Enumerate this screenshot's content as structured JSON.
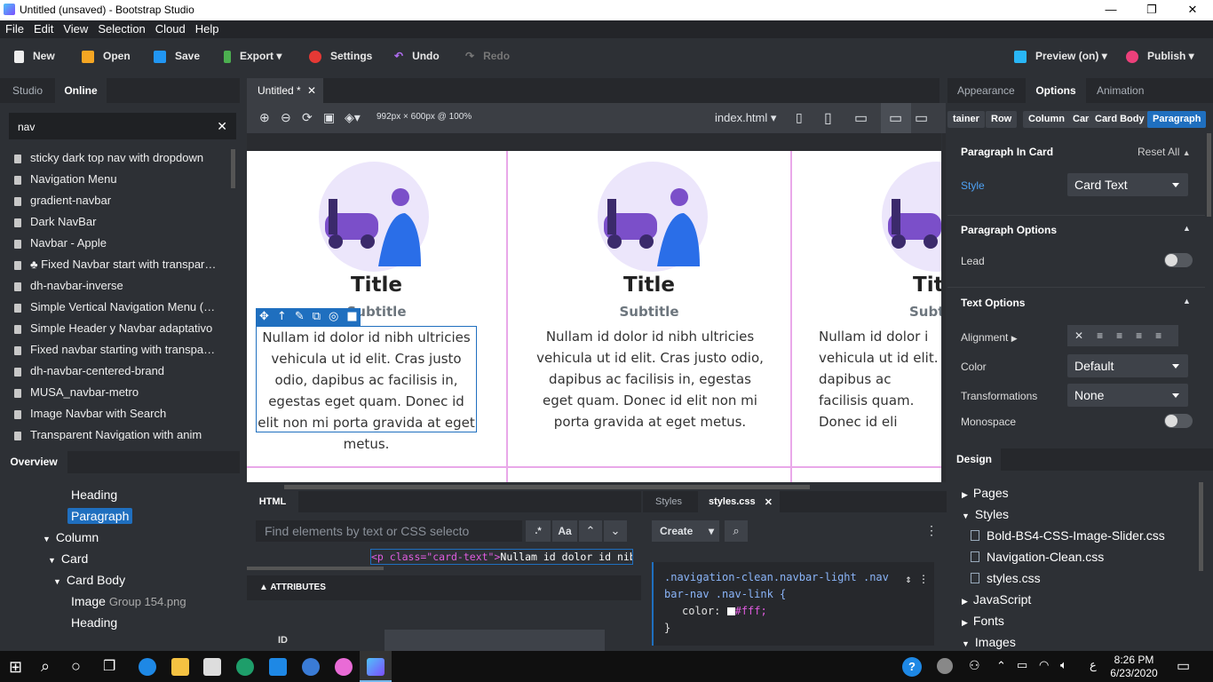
{
  "window": {
    "title": "Untitled (unsaved) - Bootstrap Studio"
  },
  "menu": [
    "File",
    "Edit",
    "View",
    "Selection",
    "Cloud",
    "Help"
  ],
  "toolbar": {
    "new": "New",
    "open": "Open",
    "save": "Save",
    "export": "Export",
    "settings": "Settings",
    "undo": "Undo",
    "redo": "Redo",
    "preview": "Preview (on)",
    "publish": "Publish"
  },
  "left": {
    "tab_studio": "Studio",
    "tab_online": "Online",
    "search": "nav",
    "items": [
      "sticky dark top nav with dropdown",
      "Navigation Menu",
      "gradient-navbar",
      "Dark NavBar",
      "Navbar - Apple",
      "♣ Fixed Navbar start with transpar…",
      "dh-navbar-inverse",
      "Simple Vertical Navigation Menu (…",
      "Simple Header y Navbar adaptativo",
      "Fixed navbar starting with transpa…",
      "dh-navbar-centered-brand",
      "MUSA_navbar-metro",
      "Image Navbar with Search",
      "Transparent Navigation with anim"
    ]
  },
  "overview": {
    "title": "Overview",
    "heading1": "Heading",
    "paragraph": "Paragraph",
    "column": "Column",
    "card": "Card",
    "card_body": "Card Body",
    "image": "Image",
    "image_name": "Group 154.png",
    "heading2": "Heading"
  },
  "canvas": {
    "tab": "Untitled *",
    "size": "992px × 600px @ 100%",
    "file": "index.html"
  },
  "cards": [
    {
      "title": "Title",
      "subtitle": "Subtitle",
      "text": "Nullam id dolor id nibh ultricies vehicula ut id elit. Cras justo odio, dapibus ac facilisis in, egestas eget quam. Donec id elit non mi porta gravida at eget metus."
    },
    {
      "title": "Title",
      "subtitle": "Subtitle",
      "text": "Nullam id dolor id nibh ultricies vehicula ut id elit. Cras justo odio, dapibus ac facilisis in, egestas eget quam. Donec id elit non mi porta gravida at eget metus."
    },
    {
      "title": "Tit",
      "subtitle": "Subt",
      "text": "Nullam id dolor i vehicula ut id elit. dapibus ac facilisis quam. Donec id eli gravida at e"
    }
  ],
  "html_panel": {
    "tab": "HTML",
    "find_placeholder": "Find elements by text or CSS selecto",
    "regex": ".*",
    "case": "Aa",
    "code_open": "<p class=\"card-text\">",
    "code_text": "Nullam id dolor id nibh ultricie",
    "attributes": "ATTRIBUTES",
    "id_label": "ID"
  },
  "css_panel": {
    "tab_styles": "Styles",
    "tab_file": "styles.css",
    "create": "Create",
    "selector": ".navigation-clean.navbar-light .nav bar-nav .nav-link {",
    "prop": "color:",
    "value": "#fff;",
    "close": "}"
  },
  "right": {
    "tab_appearance": "Appearance",
    "tab_options": "Options",
    "tab_animation": "Animation",
    "breadcrumb": [
      "tainer",
      "Row",
      "Column",
      "Card",
      "Card Body",
      "Paragraph"
    ],
    "section1": "Paragraph In Card",
    "reset": "Reset All",
    "style_label": "Style",
    "style_value": "Card Text",
    "section2": "Paragraph Options",
    "lead": "Lead",
    "section3": "Text Options",
    "alignment": "Alignment",
    "color": "Color",
    "color_value": "Default",
    "transform": "Transformations",
    "transform_value": "None",
    "mono": "Monospace"
  },
  "design": {
    "title": "Design",
    "pages": "Pages",
    "styles": "Styles",
    "files": [
      "Bold-BS4-CSS-Image-Slider.css",
      "Navigation-Clean.css",
      "styles.css"
    ],
    "js": "JavaScript",
    "fonts": "Fonts",
    "images": "Images"
  },
  "taskbar": {
    "time": "8:26 PM",
    "date": "6/23/2020",
    "lang": "ع"
  },
  "colors": {
    "accent": "#1f6fbf",
    "guide": "#e9a8e9",
    "code_attr": "#e05ce0"
  }
}
